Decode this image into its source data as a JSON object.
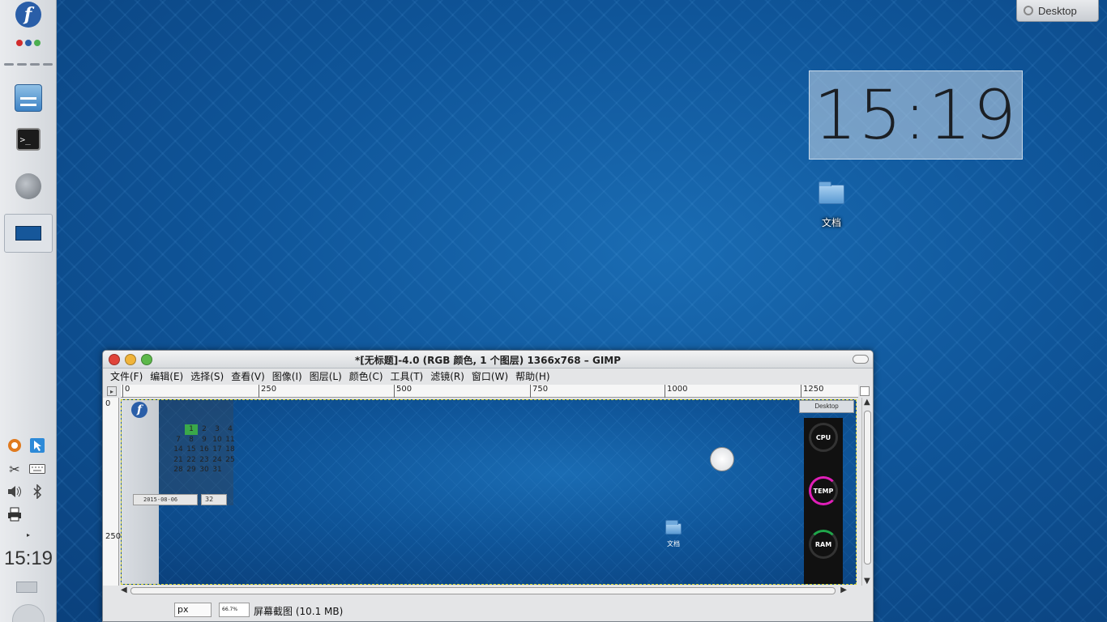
{
  "panel": {
    "clock": "15:19",
    "dot_colors": [
      "#d12c2c",
      "#2a5ea8",
      "#4caf50"
    ],
    "fedora_glyph": "f",
    "terminal_glyph": ">_",
    "launchers": [
      "file-manager-icon",
      "terminal-icon",
      "browser-icon"
    ],
    "tray_icons": [
      "fedora-app-icon",
      "cursor-app-icon",
      "scissors-icon",
      "keyboard-icon",
      "volume-icon",
      "bluetooth-icon",
      "printer-icon"
    ]
  },
  "desktop_button": {
    "label": "Desktop"
  },
  "desktop_clock": {
    "time": "15:19"
  },
  "folder": {
    "label": "文档"
  },
  "gimp": {
    "title": "*[无标题]-4.0 (RGB 颜色, 1 个图层) 1366x768 – GIMP",
    "menus": [
      "文件(F)",
      "编辑(E)",
      "选择(S)",
      "查看(V)",
      "图像(I)",
      "图层(L)",
      "颜色(C)",
      "工具(T)",
      "滤镜(R)",
      "窗口(W)",
      "帮助(H)"
    ],
    "ruler_h": [
      "0",
      "250",
      "500",
      "750",
      "1000",
      "1250"
    ],
    "ruler_v_top": "0",
    "ruler_v_mid": "250",
    "status": {
      "unit": "px",
      "zoom": "66.7%",
      "text": "屏幕截图 (10.1 MB)"
    },
    "canvas": {
      "calendar_days": [
        "",
        "",
        "1",
        "2",
        "3",
        "4",
        "",
        "7",
        "8",
        "9",
        "10",
        "11",
        "",
        "14",
        "15",
        "16",
        "17",
        "18",
        "",
        "21",
        "22",
        "23",
        "24",
        "25",
        "",
        "28",
        "29",
        "30",
        "31",
        ""
      ],
      "date": "2015-08-06",
      "number": "32",
      "desktop_label": "Desktop",
      "gauges": [
        "CPU",
        "TEMP",
        "RAM"
      ],
      "folder_label": "文档"
    }
  }
}
